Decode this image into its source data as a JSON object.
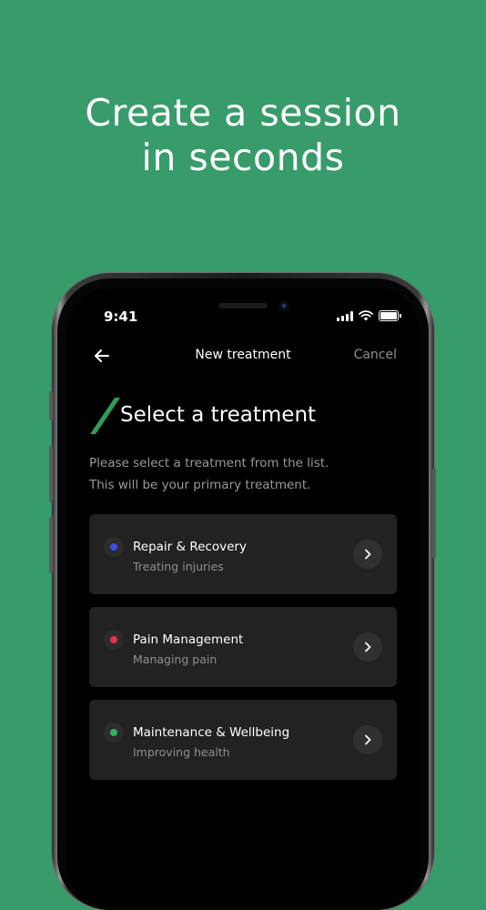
{
  "headline": {
    "line1": "Create a session",
    "line2": "in seconds"
  },
  "status_bar": {
    "time": "9:41"
  },
  "nav": {
    "back_icon": "arrow-left-icon",
    "title": "New treatment",
    "cancel_label": "Cancel"
  },
  "heading": {
    "title": "Select a treatment"
  },
  "description": {
    "line1": "Please select a treatment from the list.",
    "line2": "This will be your primary treatment."
  },
  "treatments": [
    {
      "title": "Repair & Recovery",
      "subtitle": "Treating injuries",
      "color": "#3D4EE0"
    },
    {
      "title": "Pain Management",
      "subtitle": "Managing pain",
      "color": "#E0364E"
    },
    {
      "title": "Maintenance & Wellbeing",
      "subtitle": "Improving health",
      "color": "#2DB35E"
    }
  ],
  "colors": {
    "background": "#379B6A",
    "accent": "#2E9E57",
    "screen": "#000000",
    "card": "#222222"
  }
}
